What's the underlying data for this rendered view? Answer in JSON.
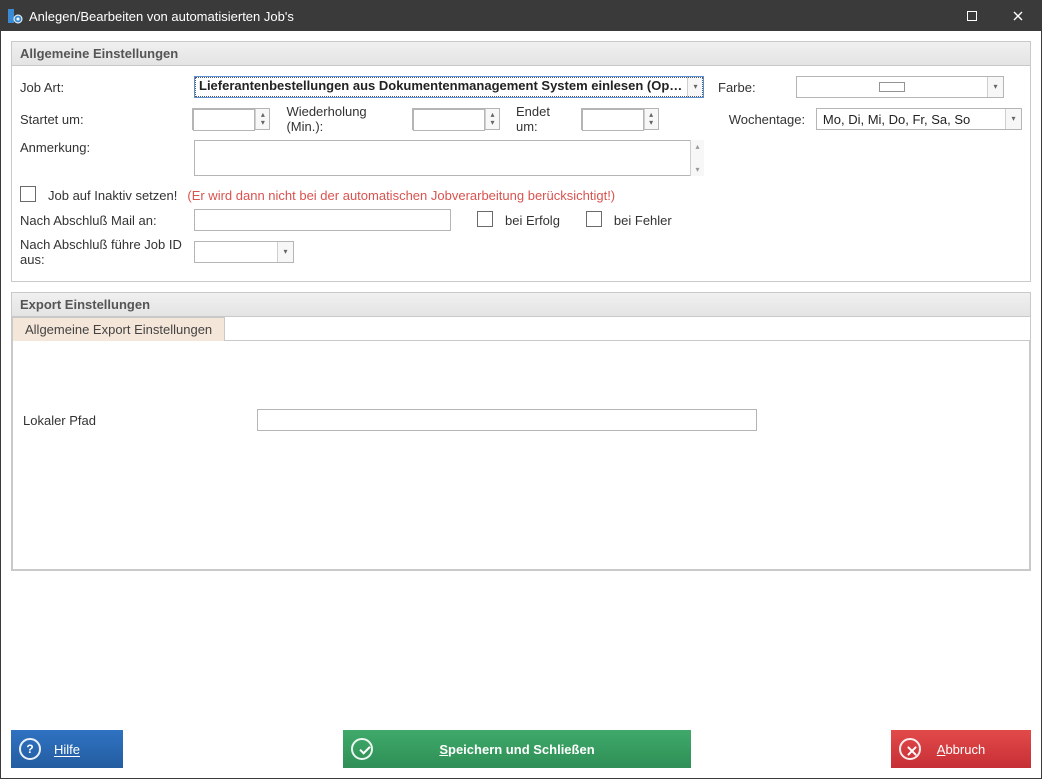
{
  "window": {
    "title": "Anlegen/Bearbeiten von automatisierten Job's"
  },
  "general": {
    "header": "Allgemeine Einstellungen",
    "labels": {
      "job_art": "Job Art:",
      "farbe": "Farbe:",
      "startet_um": "Startet um:",
      "wiederholung": "Wiederholung (Min.):",
      "endet_um": "Endet um:",
      "wochentage": "Wochentage:",
      "anmerkung": "Anmerkung:",
      "inaktiv": "Job auf Inaktiv setzen!",
      "inaktiv_hint": "(Er wird dann nicht bei der automatischen Jobverarbeitung berücksichtigt!)",
      "mail_an": "Nach Abschluß Mail an:",
      "bei_erfolg": "bei Erfolg",
      "bei_fehler": "bei Fehler",
      "job_id": "Nach Abschluß führe Job ID aus:"
    },
    "values": {
      "job_art": "Lieferantenbestellungen aus Dokumentenmanagement System einlesen (Opti...",
      "startet_um": "",
      "wiederholung": "",
      "endet_um": "",
      "wochentage": "Mo, Di, Mi, Do, Fr, Sa, So",
      "anmerkung": "",
      "mail_an": "",
      "job_id": ""
    }
  },
  "export": {
    "header": "Export Einstellungen",
    "tab": "Allgemeine Export Einstellungen",
    "local_path_label": "Lokaler Pfad",
    "local_path_value": ""
  },
  "footer": {
    "help": "Hilfe",
    "save": "Speichern und Schließen",
    "cancel": "Abbruch"
  }
}
